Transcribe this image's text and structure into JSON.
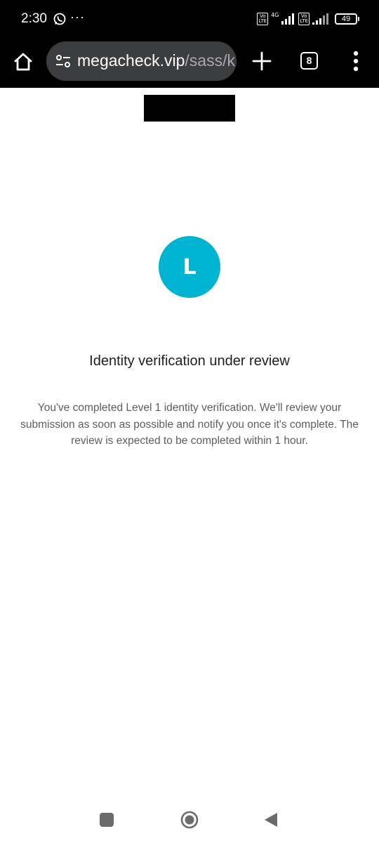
{
  "status_bar": {
    "time": "2:30",
    "more_indicator": "···",
    "volte_label_1": "Vo\nLTE",
    "network_type": "4G",
    "volte_label_2": "Vo\nLTE",
    "battery_level": "49"
  },
  "browser": {
    "url_domain": "megacheck.vip",
    "url_path": "/sass/k",
    "tab_count": "8"
  },
  "content": {
    "avatar_letter": "L",
    "title": "Identity verification under review",
    "description": "You've completed Level 1 identity verification. We'll review your submission as soon as possible and notify you once it's complete. The review is expected to be completed within 1 hour."
  },
  "colors": {
    "accent": "#00b4d1",
    "toolbar_bg": "#000000",
    "urlbar_bg": "#3c3d3f"
  },
  "icons": [
    "whatsapp-icon",
    "signal-icon",
    "battery-icon",
    "home-icon",
    "tune-icon",
    "plus-icon",
    "tab-switcher-icon",
    "more-vert-icon",
    "recents-icon",
    "nav-home-icon",
    "back-icon"
  ]
}
